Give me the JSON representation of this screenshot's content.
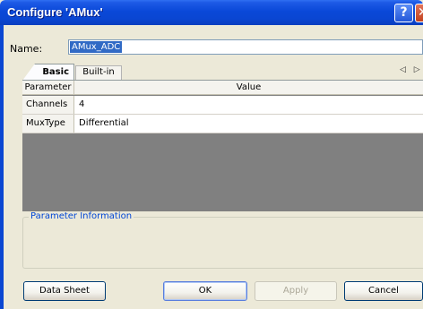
{
  "window": {
    "title": "Configure 'AMux'",
    "help_glyph": "?",
    "close_glyph": "✕"
  },
  "name_field": {
    "label": "Name:",
    "value": "AMux_ADC"
  },
  "tabs": [
    {
      "label": "Basic",
      "active": true
    },
    {
      "label": "Built-in",
      "active": false
    }
  ],
  "tab_scroll_glyph": "◁ ▷",
  "grid": {
    "headers": {
      "parameter": "Parameter",
      "value": "Value"
    },
    "rows": [
      {
        "name": "Channels",
        "value": "4"
      },
      {
        "name": "MuxType",
        "value": "Differential"
      }
    ]
  },
  "info_group": {
    "title": "Parameter Information"
  },
  "buttons": {
    "data_sheet": "Data Sheet",
    "ok": "OK",
    "apply": "Apply",
    "cancel": "Cancel"
  },
  "colors": {
    "title_bar": "#0a48d8",
    "selection": "#316ac5",
    "group_title": "#0046d5",
    "panel_bg": "#808080"
  }
}
